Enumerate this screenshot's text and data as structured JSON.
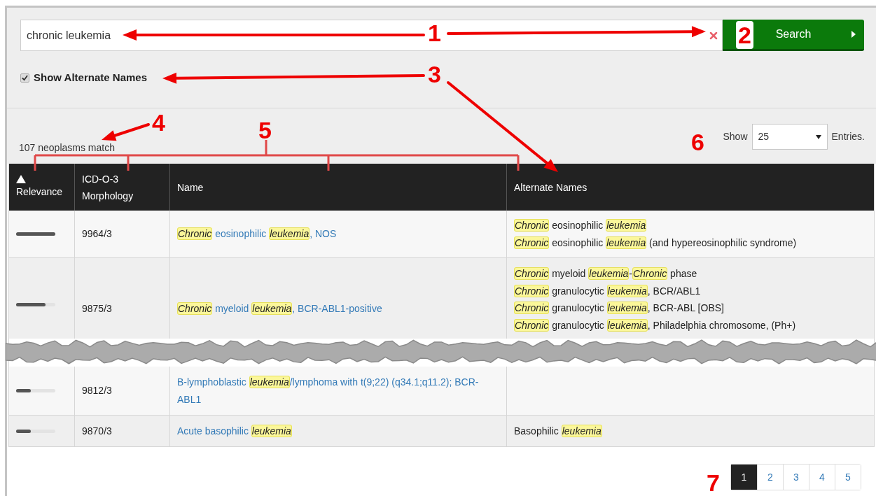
{
  "search": {
    "value": "chronic leukemia",
    "button": "Search"
  },
  "show_alternate_names": {
    "label": "Show Alternate Names",
    "checked": true
  },
  "result_count": "107 neoplasms match",
  "entries": {
    "before": "Show",
    "value": "25",
    "after": "Entries."
  },
  "table": {
    "columns": [
      {
        "label": "Relevance",
        "sorted": true
      },
      {
        "label": "ICD-O-3 Morphology",
        "sorted": false
      },
      {
        "label": "Name",
        "sorted": false
      },
      {
        "label": "Alternate Names",
        "sorted": false
      }
    ],
    "rows": [
      {
        "level": 1.0,
        "code": "9964/3",
        "name": [
          {
            "text": "Chronic",
            "highlight": true
          },
          {
            "text": " eosinophilic ",
            "highlight": false
          },
          {
            "text": "leukemia",
            "highlight": true
          },
          {
            "text": ", NOS",
            "highlight": false
          }
        ],
        "alternate_names": [
          [
            {
              "text": "Chronic",
              "highlight": true
            },
            {
              "text": " eosinophilic ",
              "highlight": false
            },
            {
              "text": "leukemia",
              "highlight": true
            }
          ],
          [
            {
              "text": "Chronic",
              "highlight": true
            },
            {
              "text": " eosinophilic ",
              "highlight": false
            },
            {
              "text": "leukemia",
              "highlight": true
            },
            {
              "text": " (and hypereosinophilic syndrome)",
              "highlight": false
            }
          ]
        ]
      },
      {
        "level": 0.75,
        "code": "9875/3",
        "name": [
          {
            "text": "Chronic",
            "highlight": true
          },
          {
            "text": " myeloid ",
            "highlight": false
          },
          {
            "text": "leukemia",
            "highlight": true
          },
          {
            "text": ", BCR-ABL1-positive",
            "highlight": false
          }
        ],
        "alternate_names": [
          [
            {
              "text": "Chronic",
              "highlight": true
            },
            {
              "text": " myeloid ",
              "highlight": false
            },
            {
              "text": "leukemia",
              "highlight": true
            },
            {
              "text": "-",
              "highlight": false
            },
            {
              "text": "Chronic",
              "highlight": true
            },
            {
              "text": " phase",
              "highlight": false
            }
          ],
          [
            {
              "text": "Chronic",
              "highlight": true
            },
            {
              "text": " granulocytic ",
              "highlight": false
            },
            {
              "text": "leukemia",
              "highlight": true
            },
            {
              "text": ", BCR/ABL1",
              "highlight": false
            }
          ],
          [
            {
              "text": "Chronic",
              "highlight": true
            },
            {
              "text": " granulocytic ",
              "highlight": false
            },
            {
              "text": "leukemia",
              "highlight": true
            },
            {
              "text": ", BCR-ABL [OBS]",
              "highlight": false
            }
          ],
          [
            {
              "text": "Chronic",
              "highlight": true
            },
            {
              "text": " granulocytic ",
              "highlight": false
            },
            {
              "text": "leukemia",
              "highlight": true
            },
            {
              "text": ", Philadelphia chromosome, (Ph+)",
              "highlight": false
            }
          ]
        ]
      },
      {
        "level": 0.38,
        "code": "9812/3",
        "name": [
          {
            "text": "B-lymphoblastic ",
            "highlight": false
          },
          {
            "text": "leukemia",
            "highlight": true
          },
          {
            "text": "/lymphoma with t(9;22) (q34.1;q11.2); BCR-ABL1",
            "highlight": false
          }
        ]
      },
      {
        "level": 0.38,
        "code": "9870/3",
        "name": [
          {
            "text": "Acute basophilic ",
            "highlight": false
          },
          {
            "text": "leukemia",
            "highlight": true
          }
        ],
        "alternate_names": [
          [
            {
              "text": "Basophilic ",
              "highlight": false
            },
            {
              "text": "leukemia",
              "highlight": true
            }
          ]
        ]
      }
    ]
  },
  "pagination": [
    {
      "label": "1",
      "selected": true
    },
    {
      "label": "2",
      "selected": false
    },
    {
      "label": "3",
      "selected": false
    },
    {
      "label": "4",
      "selected": false
    },
    {
      "label": "5",
      "selected": false
    }
  ],
  "annotations": [
    {
      "label": "1"
    },
    {
      "label": "2"
    },
    {
      "label": "3"
    },
    {
      "label": "4"
    },
    {
      "label": "5"
    },
    {
      "label": "6"
    },
    {
      "label": "7"
    }
  ]
}
